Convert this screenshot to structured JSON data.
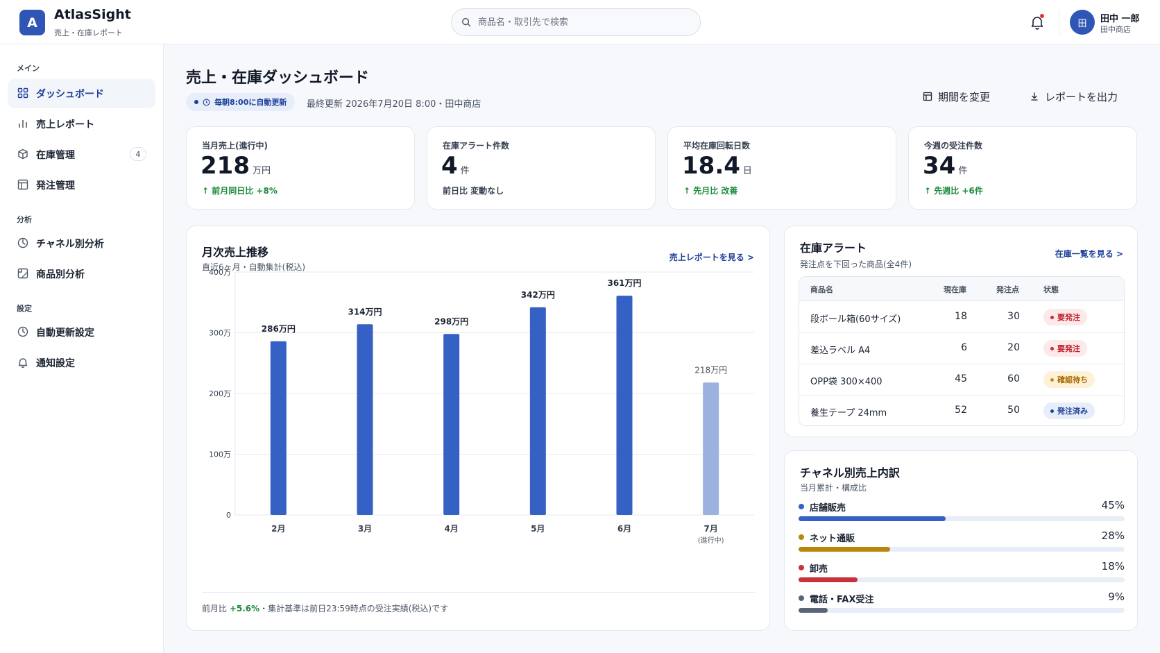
{
  "app": {
    "logo_letter": "A",
    "name": "AtlasSight",
    "subtitle": "売上・在庫レポート"
  },
  "search": {
    "placeholder": "商品名・取引先で検索",
    "value": ""
  },
  "user": {
    "avatar_letter": "田",
    "name": "田中 一郎",
    "shop": "田中商店"
  },
  "sidebar": {
    "sections": [
      {
        "label": "メイン"
      },
      {
        "label": "分析"
      },
      {
        "label": "設定"
      }
    ],
    "items": [
      {
        "label": "ダッシュボード",
        "active": true,
        "icon": "grid-icon"
      },
      {
        "label": "売上レポート",
        "icon": "bar-chart-icon"
      },
      {
        "label": "在庫管理",
        "badge": "4",
        "icon": "box-icon"
      },
      {
        "label": "発注管理",
        "icon": "layout-icon"
      },
      {
        "label": "チャネル別分析",
        "icon": "pie-clock-icon"
      },
      {
        "label": "商品別分析",
        "icon": "tag-icon"
      },
      {
        "label": "自動更新設定",
        "icon": "clock-icon"
      },
      {
        "label": "通知設定",
        "icon": "bell-icon"
      }
    ]
  },
  "main": {
    "title": "売上・在庫ダッシュボード",
    "auto_pill": "毎朝8:00に自動更新",
    "last_update": "最終更新 2026年7月20日 8:00・田中商店",
    "btn_period": "期間を変更",
    "btn_export": "レポートを出力"
  },
  "kpis": [
    {
      "label": "当月売上(進行中)",
      "value": "218",
      "unit": "万円",
      "delta": "前月同日比 +8%",
      "trend": "up"
    },
    {
      "label": "在庫アラート件数",
      "value": "4",
      "unit": "件",
      "delta": "前日比 変動なし",
      "trend": "none"
    },
    {
      "label": "平均在庫回転日数",
      "value": "18.4",
      "unit": "日",
      "delta": "先月比 改善",
      "trend": "up"
    },
    {
      "label": "今週の受注件数",
      "value": "34",
      "unit": "件",
      "delta": "先週比 +6件",
      "trend": "up"
    }
  ],
  "sales_panel": {
    "title": "月次売上推移",
    "subtitle": "直近6ヶ月・自動集計(税込)",
    "link": "売上レポートを見る >",
    "footer_prefix": "前月比 ",
    "footer_value": "+5.6%",
    "footer_suffix": "・集計基準は前日23:59時点の受注実績(税込)です"
  },
  "chart_data": {
    "type": "bar",
    "categories": [
      "2月",
      "3月",
      "4月",
      "5月",
      "6月",
      "7月"
    ],
    "category_notes": [
      "",
      "",
      "",
      "",
      "",
      "(進行中)"
    ],
    "values": [
      286,
      314,
      298,
      342,
      361,
      218
    ],
    "data_labels": [
      "286万円",
      "314万円",
      "298万円",
      "342万円",
      "361万円",
      "218万円"
    ],
    "in_progress_index": 5,
    "y_ticks": [
      0,
      100,
      200,
      300,
      400
    ],
    "y_tick_labels": [
      "0",
      "100万",
      "200万",
      "300万",
      "400万"
    ],
    "ylim": [
      0,
      400
    ],
    "grid": true,
    "colors": {
      "bar": "#3560c4",
      "bar_in_progress": "#9bb1de"
    }
  },
  "inventory": {
    "title": "在庫アラート",
    "subtitle": "発注点を下回った商品(全4件)",
    "link": "在庫一覧を見る >",
    "headers": [
      "商品名",
      "現在庫",
      "発注点",
      "状態"
    ],
    "rows": [
      {
        "name": "段ボール箱(60サイズ)",
        "stock": "18",
        "reorder": "30",
        "status": "要発注",
        "kind": "danger"
      },
      {
        "name": "差込ラベル A4",
        "stock": "6",
        "reorder": "20",
        "status": "要発注",
        "kind": "danger"
      },
      {
        "name": "OPP袋 300×400",
        "stock": "45",
        "reorder": "60",
        "status": "確認待ち",
        "kind": "warn"
      },
      {
        "name": "養生テープ 24mm",
        "stock": "52",
        "reorder": "50",
        "status": "発注済み",
        "kind": "info"
      }
    ]
  },
  "channels": {
    "title": "チャネル別売上内訳",
    "subtitle": "当月累計・構成比",
    "items": [
      {
        "name": "店舗販売",
        "pct": "45%",
        "value": 45,
        "color": "#3560c4"
      },
      {
        "name": "ネット通販",
        "pct": "28%",
        "value": 28,
        "color": "#b8860b"
      },
      {
        "name": "卸売",
        "pct": "18%",
        "value": 18,
        "color": "#c8323a"
      },
      {
        "name": "電話・FAX受注",
        "pct": "9%",
        "value": 9,
        "color": "#5a6478"
      }
    ]
  }
}
